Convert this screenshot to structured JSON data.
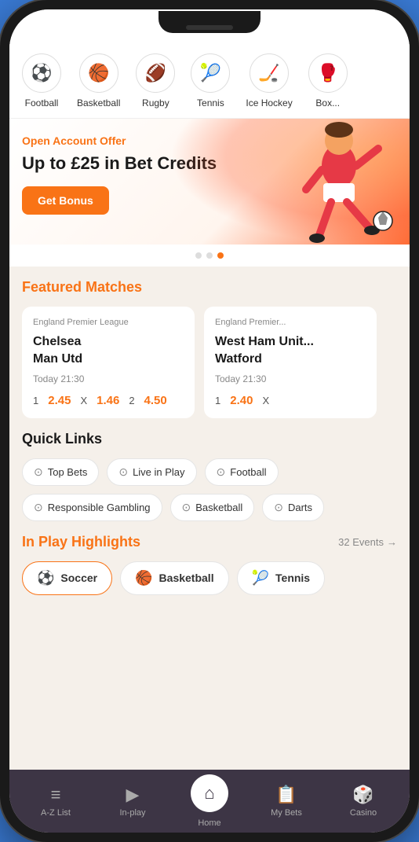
{
  "sports_nav": {
    "items": [
      {
        "id": "football",
        "label": "Football",
        "icon": "⚽"
      },
      {
        "id": "basketball",
        "label": "Basketball",
        "icon": "🏀"
      },
      {
        "id": "rugby",
        "label": "Rugby",
        "icon": "🏈"
      },
      {
        "id": "tennis",
        "label": "Tennis",
        "icon": "🎾"
      },
      {
        "id": "ice_hockey",
        "label": "Ice Hockey",
        "icon": "🏒"
      },
      {
        "id": "boxing",
        "label": "Box...",
        "icon": "🥊"
      }
    ]
  },
  "hero": {
    "offer_label": "Open Account Offer",
    "title": "Up to £25 in Bet Credits",
    "btn_label": "Get Bonus"
  },
  "featured_matches": {
    "title": "Featured Matches",
    "cards": [
      {
        "league": "England Premier League",
        "team1": "Chelsea",
        "team2": "Man Utd",
        "time": "Today 21:30",
        "odds": [
          {
            "label": "1",
            "value": "2.45"
          },
          {
            "label": "X",
            "value": "1.46"
          },
          {
            "label": "2",
            "value": "4.50"
          }
        ]
      },
      {
        "league": "England Premier...",
        "team1": "West Ham Unit...",
        "team2": "Watford",
        "time": "Today 21:30",
        "odds": [
          {
            "label": "1",
            "value": "2.40"
          },
          {
            "label": "X",
            "value": ""
          }
        ]
      }
    ]
  },
  "quick_links": {
    "title": "Quick Links",
    "items": [
      {
        "label": "Top Bets",
        "icon": "⚙"
      },
      {
        "label": "Live in Play",
        "icon": "⚙"
      },
      {
        "label": "Football",
        "icon": "⚙"
      },
      {
        "label": "Responsible Gambling",
        "icon": "⚙"
      },
      {
        "label": "Basketball",
        "icon": "⚙"
      },
      {
        "label": "Darts",
        "icon": ""
      }
    ]
  },
  "in_play": {
    "title": "In Play Highlights",
    "events_count": "32 Events",
    "tabs": [
      {
        "label": "Soccer",
        "icon": "⚽",
        "active": true
      },
      {
        "label": "Basketball",
        "icon": "🏀",
        "active": false
      },
      {
        "label": "Tennis",
        "icon": "🎾",
        "active": false
      }
    ]
  },
  "bottom_nav": {
    "items": [
      {
        "label": "A-Z List",
        "icon": "≡"
      },
      {
        "label": "In-play",
        "icon": "▶"
      },
      {
        "label": "Home",
        "icon": "⌂"
      },
      {
        "label": "My Bets",
        "icon": "📋"
      },
      {
        "label": "Casino",
        "icon": "🎲"
      }
    ]
  },
  "dots": [
    {
      "active": false
    },
    {
      "active": false
    },
    {
      "active": true
    }
  ]
}
